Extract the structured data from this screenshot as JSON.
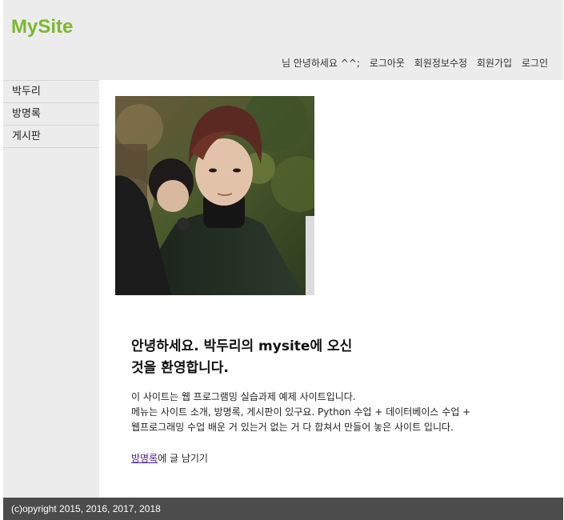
{
  "header": {
    "logo": "MySite",
    "nav": {
      "greeting": "님 안녕하세요 ^^;",
      "logout": "로그아웃",
      "edit_profile": "회원정보수정",
      "signup": "회원가입",
      "login": "로그인"
    }
  },
  "sidebar": {
    "items": [
      {
        "label": "박두리"
      },
      {
        "label": "방명록"
      },
      {
        "label": "게시판"
      }
    ]
  },
  "main": {
    "welcome_line1": "안녕하세요. 박두리의 mysite에 오신",
    "welcome_line2": "것을 환영합니다.",
    "intro_line1": "이 사이트는 웹 프로그램밍 실습과제 예제 사이트입니다.",
    "intro_line2": "메뉴는 사이트 소개, 방명록, 게시판이 있구요. Python 수업 + 데이터베이스 수업 +",
    "intro_line3": "웹프로그래밍 수업 배운 거 있는거 없는 거 다 합쳐서 만들어 놓은 사이트 입니다.",
    "guestbook_link": "방명록",
    "guestbook_suffix": "에 글 남기기"
  },
  "footer": {
    "copyright": "(c)opyright 2015, 2016, 2017, 2018"
  },
  "colors": {
    "logo": "#7cb82f",
    "header_bg": "#ececec",
    "footer_bg": "#4c4c4c"
  }
}
